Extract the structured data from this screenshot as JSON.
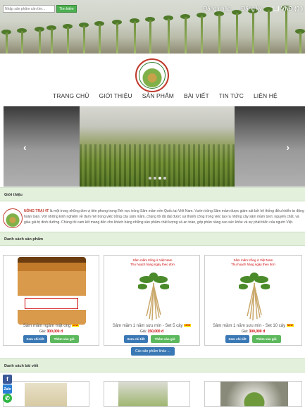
{
  "search": {
    "placeholder": "Nhập sản phẩm cần tìm...",
    "button": "Tìm kiếm"
  },
  "header": {
    "login": "Đăng nhập",
    "register": "Đăng ký",
    "cart": "VNĐ (0 )"
  },
  "nav": [
    "TRANG CHỦ",
    "GIỚI THIỆU",
    "SẢN PHẨM",
    "BÀI VIẾT",
    "TIN TỨC",
    "LIÊN HỆ"
  ],
  "slider": {
    "prev": "‹",
    "next": "›",
    "dots": 4,
    "active_dot": 2
  },
  "sections": {
    "intro": "Giới thiệu",
    "products": "Danh sách sản phẩm",
    "posts": "Danh sách bài viết"
  },
  "intro": {
    "brand": "NÔNG TRẠI 4T",
    "text": " là một trong những đơn vị tiên phong trong lĩnh vực trồng Sâm mầm nền Quốc tại Việt Nam. Vườn trồng Sâm mầm được giám sát bởi hệ thống điều khiển tự động hoàn toàn. Với những kinh nghiệm về đam mê trong việc trồng cây sâm mầm, chúng tôi đã đạt được sự thành công trong việc tạo ra những cây sâm mầm tươi, nguyên chất, và giàu giá trị dinh dưỡng. Chúng tôi cam kết mang đến cho khách hàng những sản phẩm chất lượng và an toàn, góp phần nâng cao sức khỏe và sự phát triển của người Việt."
  },
  "products": [
    {
      "name": "Sâm mầm ngâm mật ong",
      "price_label": "Giá: ",
      "price": "300,000 đ",
      "detail": "Xem chi tiết",
      "add": "Thêm vào giỏ",
      "image": "jar"
    },
    {
      "name": "Sâm mầm 1 năm sưu mìn - Set 5 cây",
      "price_label": "Giá: ",
      "price": "150,000 đ",
      "detail": "Xem chi tiết",
      "add": "Thêm vào giỏ",
      "image": "sprout",
      "img_line1": "Sâm mầm trồng ở Việt Nam",
      "img_line2": "Thu hoạch hàng ngày theo đơn"
    },
    {
      "name": "Sâm mầm 1 năm sưu mìn - Set 10 cây",
      "price_label": "Giá: ",
      "price": "300,000 đ",
      "detail": "Xem chi tiết",
      "add": "Thêm vào giỏ",
      "image": "sprout",
      "img_line1": "Sâm mầm trồng ở Việt Nam",
      "img_line2": "Thu hoạch hàng ngày theo đơn"
    }
  ],
  "badge_new": "NEW",
  "more_button": "Các sản phẩm khác ...",
  "colors": {
    "accent_green": "#5cb85c",
    "accent_blue": "#3a78b5",
    "section_bg": "#e3f0dc",
    "price_red": "#cc0000"
  }
}
